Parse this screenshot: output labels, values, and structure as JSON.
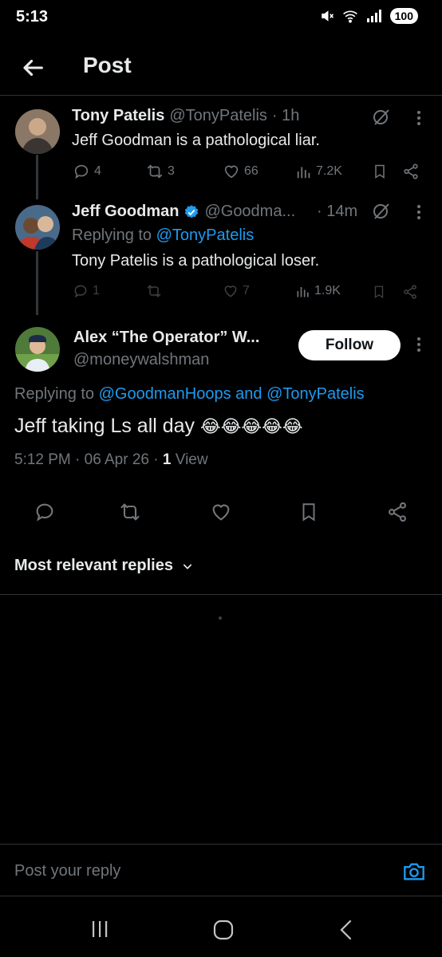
{
  "status_bar": {
    "time": "5:13",
    "battery": "100"
  },
  "header": {
    "title": "Post"
  },
  "tweets": [
    {
      "name": "Tony Patelis",
      "handle": "@TonyPatelis",
      "time": "· 1h",
      "text": "Jeff Goodman is a pathological liar.",
      "replies": "4",
      "reposts": "3",
      "likes": "66",
      "views": "7.2K"
    },
    {
      "name": "Jeff Goodman",
      "handle": "@Goodma...",
      "time": "· 14m",
      "replying_prefix": "Replying to",
      "replying_to": "@TonyPatelis",
      "text": "Tony Patelis is a pathological loser.",
      "replies": "1",
      "likes": "7",
      "views": "1.9K"
    }
  ],
  "main_post": {
    "name": "Alex “The Operator” W...",
    "handle": "@moneywalshman",
    "follow_label": "Follow",
    "replying_prefix": "Replying to",
    "replying_to_1": "@GoodmanHoops",
    "replying_and": "and",
    "replying_to_2": "@TonyPatelis",
    "text": "Jeff taking Ls all day",
    "emoji": "😂😂😂😂😂",
    "timestamp": "5:12 PM · 06 Apr 26 ·",
    "views_count": "1",
    "views_label": "View"
  },
  "replies_section": {
    "sort_label": "Most relevant replies"
  },
  "composer": {
    "placeholder": "Post your reply"
  },
  "colors": {
    "accent": "#1d9bf0",
    "background": "#000000",
    "muted": "#71767b"
  }
}
